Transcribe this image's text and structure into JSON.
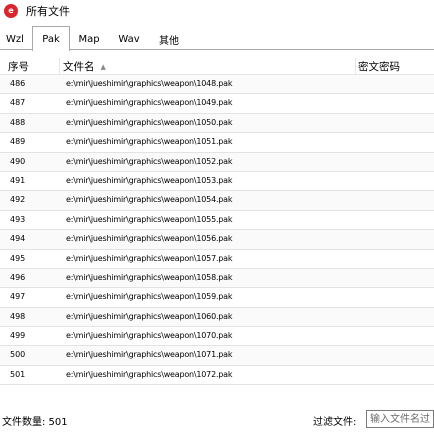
{
  "window": {
    "title": "所有文件",
    "icon": "app-logo-icon",
    "icon_glyph": "e",
    "accent_color": "#d9252c"
  },
  "tabs": [
    {
      "label": "Wzl",
      "selected": false
    },
    {
      "label": "Pak",
      "selected": true
    },
    {
      "label": "Map",
      "selected": false
    },
    {
      "label": "Wav",
      "selected": false
    },
    {
      "label": "其他",
      "selected": false
    }
  ],
  "table": {
    "columns": {
      "index": "序号",
      "filename": "文件名",
      "sort_icon": "sort-ascending-icon",
      "password": "密文密码"
    },
    "rows": [
      {
        "index": "486",
        "filename": "e:\\mir\\jueshimir\\graphics\\weapon\\1048.pak",
        "password": ""
      },
      {
        "index": "487",
        "filename": "e:\\mir\\jueshimir\\graphics\\weapon\\1049.pak",
        "password": ""
      },
      {
        "index": "488",
        "filename": "e:\\mir\\jueshimir\\graphics\\weapon\\1050.pak",
        "password": ""
      },
      {
        "index": "489",
        "filename": "e:\\mir\\jueshimir\\graphics\\weapon\\1051.pak",
        "password": ""
      },
      {
        "index": "490",
        "filename": "e:\\mir\\jueshimir\\graphics\\weapon\\1052.pak",
        "password": ""
      },
      {
        "index": "491",
        "filename": "e:\\mir\\jueshimir\\graphics\\weapon\\1053.pak",
        "password": ""
      },
      {
        "index": "492",
        "filename": "e:\\mir\\jueshimir\\graphics\\weapon\\1054.pak",
        "password": ""
      },
      {
        "index": "493",
        "filename": "e:\\mir\\jueshimir\\graphics\\weapon\\1055.pak",
        "password": ""
      },
      {
        "index": "494",
        "filename": "e:\\mir\\jueshimir\\graphics\\weapon\\1056.pak",
        "password": ""
      },
      {
        "index": "495",
        "filename": "e:\\mir\\jueshimir\\graphics\\weapon\\1057.pak",
        "password": ""
      },
      {
        "index": "496",
        "filename": "e:\\mir\\jueshimir\\graphics\\weapon\\1058.pak",
        "password": ""
      },
      {
        "index": "497",
        "filename": "e:\\mir\\jueshimir\\graphics\\weapon\\1059.pak",
        "password": ""
      },
      {
        "index": "498",
        "filename": "e:\\mir\\jueshimir\\graphics\\weapon\\1060.pak",
        "password": ""
      },
      {
        "index": "499",
        "filename": "e:\\mir\\jueshimir\\graphics\\weapon\\1070.pak",
        "password": ""
      },
      {
        "index": "500",
        "filename": "e:\\mir\\jueshimir\\graphics\\weapon\\1071.pak",
        "password": ""
      },
      {
        "index": "501",
        "filename": "e:\\mir\\jueshimir\\graphics\\weapon\\1072.pak",
        "password": ""
      }
    ]
  },
  "status": {
    "file_count": "文件数量: 501",
    "filter_label": "过滤文件:",
    "filter_placeholder": "输入文件名过",
    "filter_value": ""
  }
}
